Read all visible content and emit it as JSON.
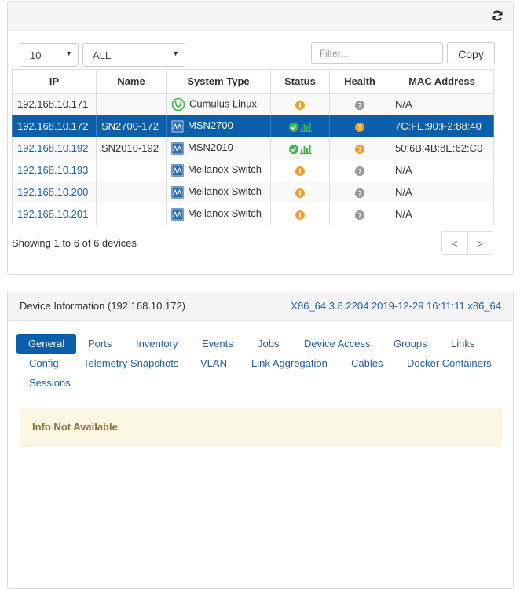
{
  "toolbar": {
    "refresh_icon": "refresh-icon",
    "page_size": "10",
    "type_filter": "ALL",
    "filter_placeholder": "Filter...",
    "copy_label": "Copy"
  },
  "table": {
    "headers": [
      "IP",
      "Name",
      "System Type",
      "Status",
      "Health",
      "MAC Address"
    ],
    "rows": [
      {
        "ip": "192.168.10.171",
        "name": "",
        "system_type": "Cumulus Linux",
        "system_icon": "cumulus-icon",
        "status": "info",
        "health": "unknown",
        "mac": "N/A"
      },
      {
        "ip": "192.168.10.172",
        "name": "SN2700-172",
        "system_type": "MSN2700",
        "system_icon": "mellanox-icon",
        "status": "ok",
        "health": "warning",
        "mac": "7C:FE:90:F2:88:40"
      },
      {
        "ip": "192.168.10.192",
        "name": "SN2010-192",
        "system_type": "MSN2010",
        "system_icon": "mellanox-icon",
        "status": "ok",
        "health": "warning",
        "mac": "50:6B:4B:8E:62:C0"
      },
      {
        "ip": "192.168.10.193",
        "name": "",
        "system_type": "Mellanox Switch",
        "system_icon": "mellanox-icon",
        "status": "info",
        "health": "unknown",
        "mac": "N/A"
      },
      {
        "ip": "192.168.10.200",
        "name": "",
        "system_type": "Mellanox Switch",
        "system_icon": "mellanox-icon",
        "status": "info",
        "health": "unknown",
        "mac": "N/A"
      },
      {
        "ip": "192.168.10.201",
        "name": "",
        "system_type": "Mellanox Switch",
        "system_icon": "mellanox-icon",
        "status": "info",
        "health": "unknown",
        "mac": "N/A"
      }
    ],
    "selected_row": 1
  },
  "footer": {
    "showing": "Showing 1 to 6 of 6 devices",
    "prev": "<",
    "next": ">"
  },
  "device_info": {
    "title": "Device Information (192.168.10.172)",
    "version": "X86_64 3.8.2204 2019-12-29 16:11:11 x86_64",
    "tabs": [
      "General",
      "Ports",
      "Inventory",
      "Events",
      "Jobs",
      "Device Access",
      "Groups",
      "Links",
      "Config",
      "Telemetry Snapshots",
      "VLAN",
      "Link Aggregation",
      "Cables",
      "Docker Containers",
      "Sessions"
    ],
    "active_tab": "General",
    "alert": "Info Not Available"
  },
  "colors": {
    "accent": "#0a5eaa",
    "link": "#1d5e9e",
    "ok_green": "#3db847",
    "info_orange": "#f0a030",
    "health_gray": "#999999",
    "alert_bg": "#fcf8e3"
  }
}
